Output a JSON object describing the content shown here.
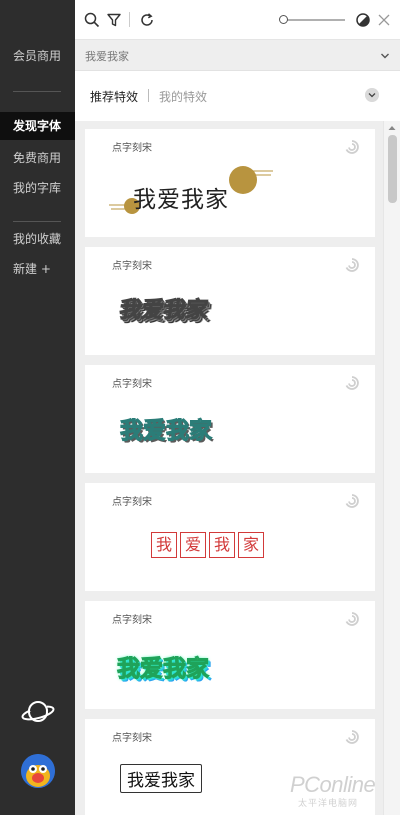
{
  "sidebar": {
    "vip": "会员商用",
    "discover": "发现字体",
    "free_commercial": "免费商用",
    "my_fonts": "我的字库",
    "my_favorites": "我的收藏",
    "new": "新建 +"
  },
  "toolbar": {
    "icons": [
      "search-icon",
      "filter-icon",
      "refresh-icon",
      "theme-contrast-icon",
      "close-icon"
    ],
    "size_slider_level": 0.05
  },
  "preview": {
    "value": "我爱我家"
  },
  "tabs": {
    "recommended": "推荐特效",
    "mine": "我的特效"
  },
  "cards": [
    {
      "font": "点字刻宋",
      "text": "我爱我家",
      "style": "sun-decor"
    },
    {
      "font": "点字刻宋",
      "text": "我爱我家",
      "style": "striped-3d"
    },
    {
      "font": "点字刻宋",
      "text": "我爱我家",
      "style": "teal-hatched"
    },
    {
      "font": "点字刻宋",
      "text": "我",
      "text2": "爱",
      "text3": "我",
      "text4": "家",
      "style": "red-boxed"
    },
    {
      "font": "点字刻宋",
      "text": "我爱我家",
      "style": "neon-gradient"
    },
    {
      "font": "点字刻宋",
      "text": "我爱我家",
      "style": "framed"
    }
  ],
  "watermark": {
    "main": "PConline",
    "sub": "太平洋电脑网"
  },
  "colors": {
    "sidebar_bg": "#2d2d2d",
    "active_item_bg": "#0f0f0f",
    "accent_gold": "#b8943f",
    "stamp_red": "#d23a3a"
  }
}
